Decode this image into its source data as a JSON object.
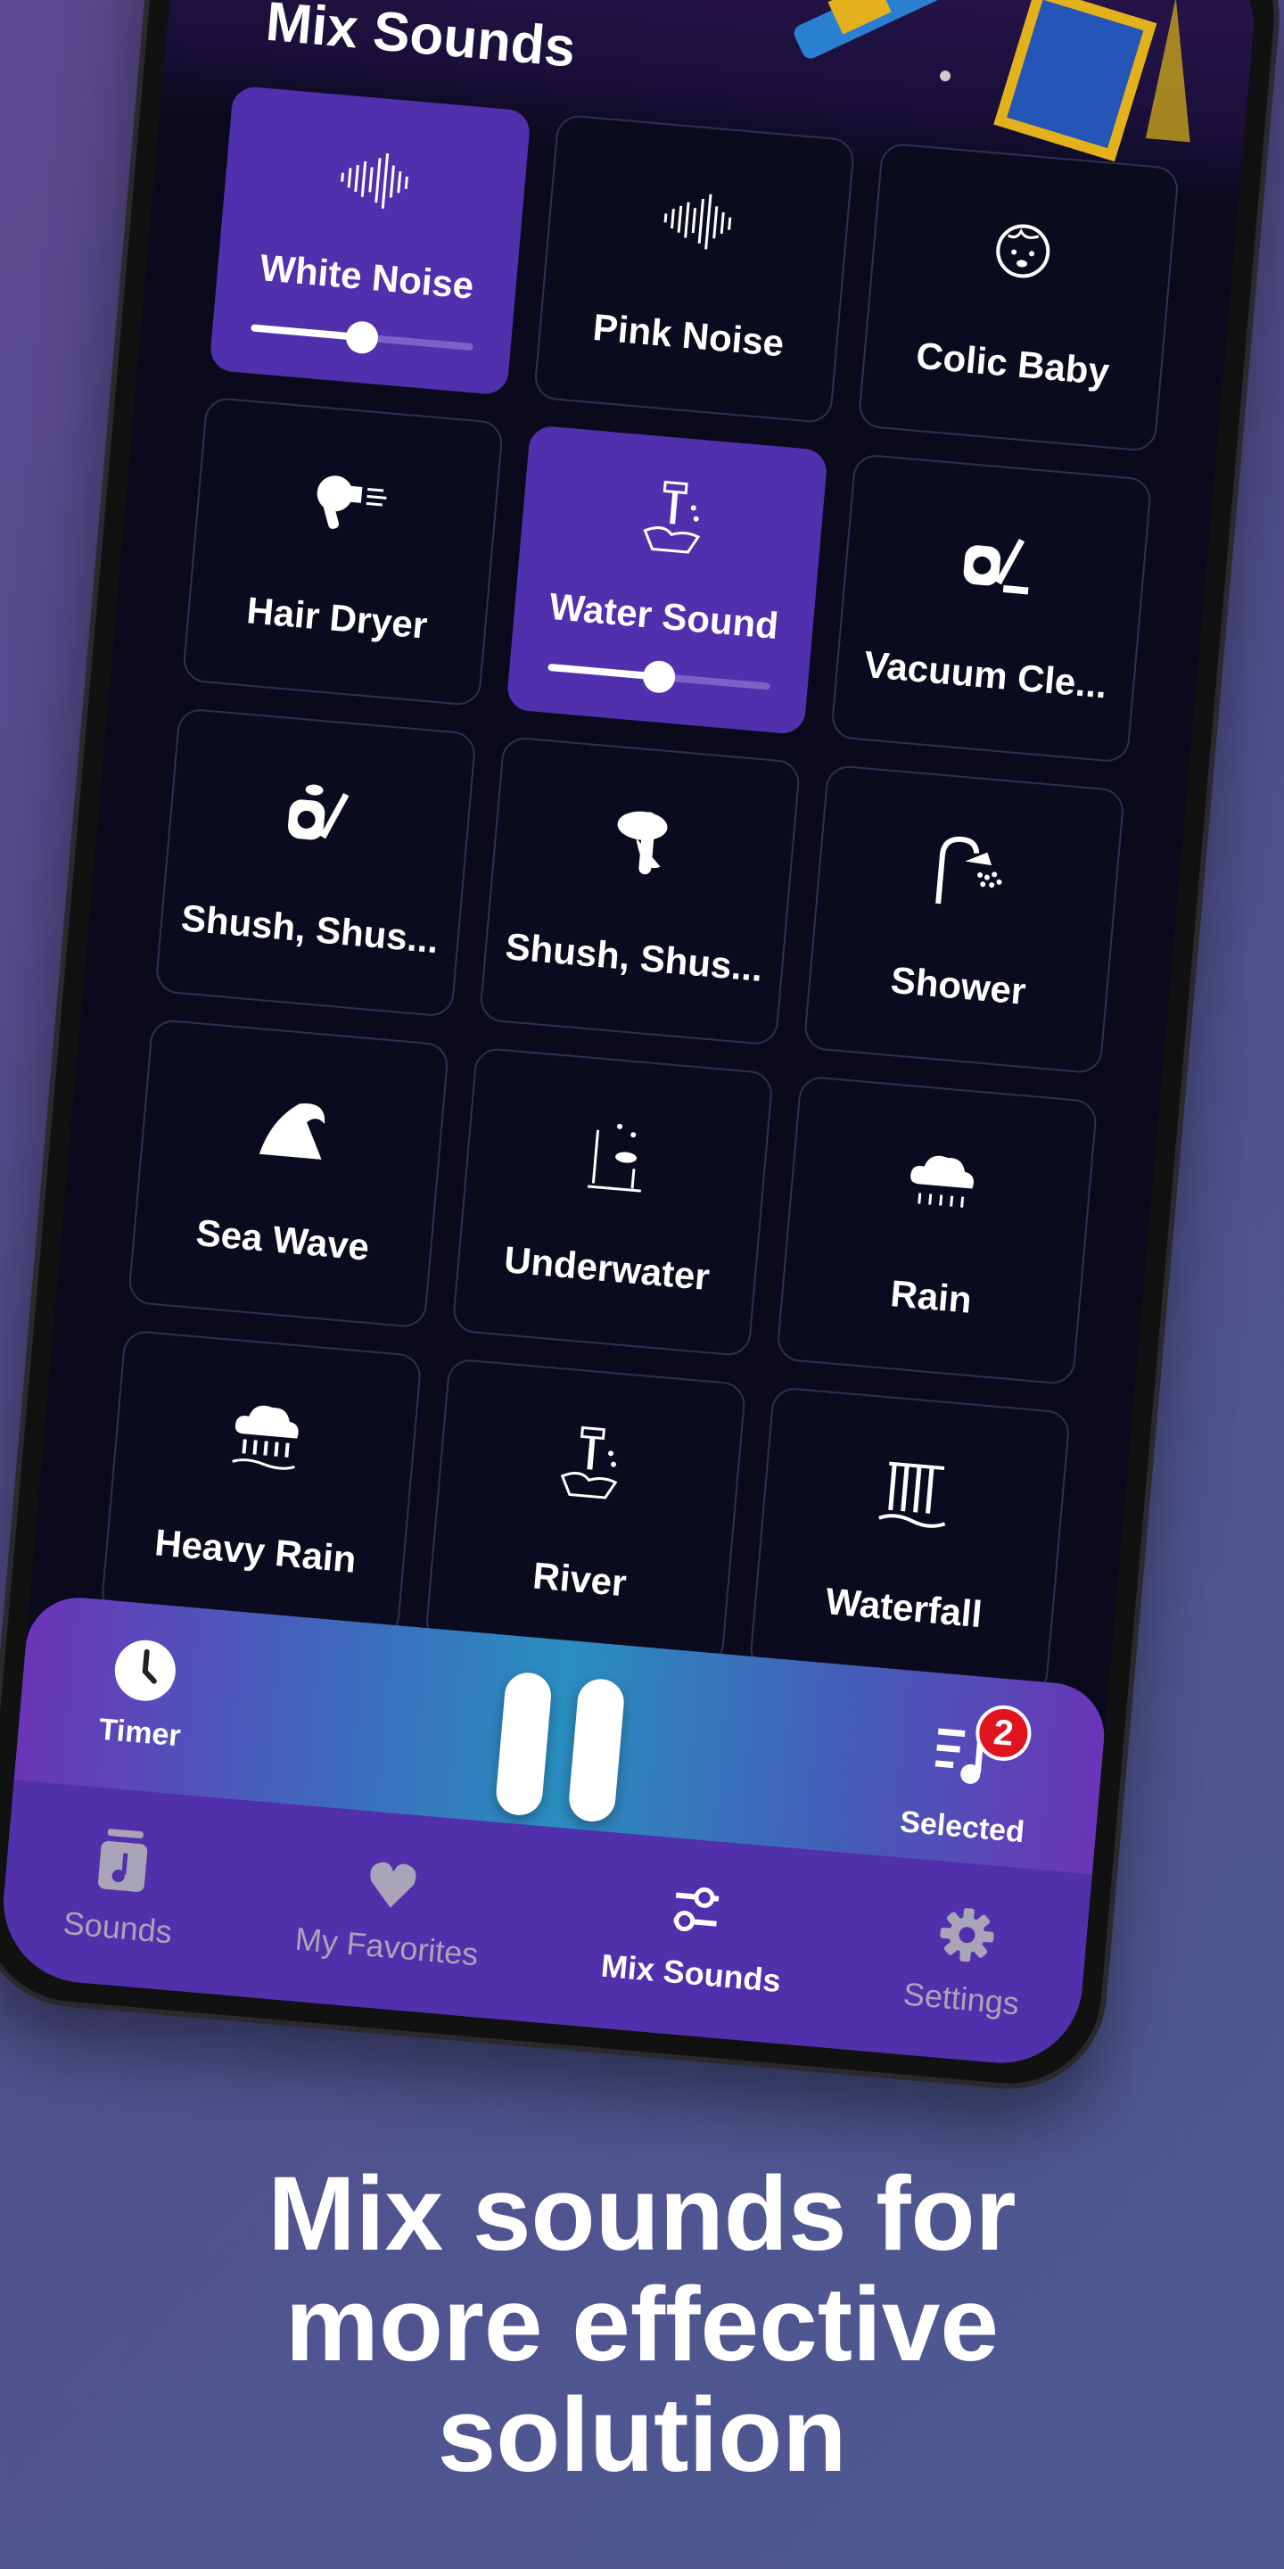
{
  "header": {
    "title": "Mix Sounds"
  },
  "sounds": [
    {
      "label": "White Noise",
      "icon": "waveform-icon",
      "active": true,
      "volume": 0.5
    },
    {
      "label": "Pink Noise",
      "icon": "waveform-icon",
      "active": false
    },
    {
      "label": "Colic Baby",
      "icon": "baby-face-icon",
      "active": false
    },
    {
      "label": "Hair Dryer",
      "icon": "hair-dryer-icon",
      "active": false
    },
    {
      "label": "Water Sound",
      "icon": "tap-hand-icon",
      "active": true,
      "volume": 0.5
    },
    {
      "label": "Vacuum Cle...",
      "icon": "vacuum-icon",
      "active": false
    },
    {
      "label": "Shush, Shus...",
      "icon": "vacuum-lips-icon",
      "active": false
    },
    {
      "label": "Shush, Shus...",
      "icon": "shush-finger-icon",
      "active": false
    },
    {
      "label": "Shower",
      "icon": "shower-icon",
      "active": false
    },
    {
      "label": "Sea Wave",
      "icon": "wave-icon",
      "active": false
    },
    {
      "label": "Underwater",
      "icon": "underwater-icon",
      "active": false
    },
    {
      "label": "Rain",
      "icon": "rain-cloud-icon",
      "active": false
    },
    {
      "label": "Heavy Rain",
      "icon": "heavy-rain-icon",
      "active": false
    },
    {
      "label": "River",
      "icon": "tap-hand-icon",
      "active": false
    },
    {
      "label": "Waterfall",
      "icon": "waterfall-icon",
      "active": false
    }
  ],
  "player": {
    "timer_label": "Timer",
    "selected_label": "Selected",
    "selected_count": "2",
    "state": "playing"
  },
  "nav": [
    {
      "label": "Sounds",
      "icon": "music-jar-icon",
      "active": false
    },
    {
      "label": "My Favorites",
      "icon": "heart-icon",
      "active": false
    },
    {
      "label": "Mix Sounds",
      "icon": "sliders-icon",
      "active": true
    },
    {
      "label": "Settings",
      "icon": "gear-icon",
      "active": false
    }
  ],
  "headline": {
    "line1": "Mix sounds for",
    "line2": "more effective",
    "line3": "solution"
  },
  "colors": {
    "accent": "#5130ad",
    "badge": "#e0141e",
    "background": "#0a0a1c"
  }
}
